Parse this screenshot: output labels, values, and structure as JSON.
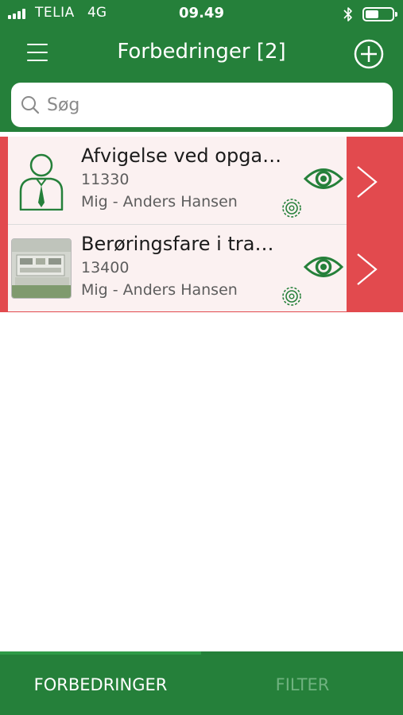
{
  "status_bar": {
    "carrier": "TELIA",
    "network": "4G",
    "time": "09.49",
    "signal_bars": 4,
    "battery_level": 0.35
  },
  "header": {
    "title": "Forbedringer [2]",
    "menu_icon": "hamburger-icon",
    "add_icon": "plus-circle-icon"
  },
  "search": {
    "placeholder": "Søg",
    "value": ""
  },
  "items": [
    {
      "title": "Afvigelse ved opga…",
      "id": "11330",
      "owner": "Mig - Anders Hansen",
      "thumbnail": "person-icon"
    },
    {
      "title": "Berøringsfare i tra…",
      "id": "13400",
      "owner": "Mig - Anders Hansen",
      "thumbnail": "photo"
    }
  ],
  "tabs": [
    {
      "label": "FORBEDRINGER",
      "active": true
    },
    {
      "label": "FILTER",
      "active": false
    }
  ],
  "colors": {
    "brand_green": "#25803a",
    "accent_red": "#e24a4e",
    "row_background": "#fbf1f1",
    "inactive_tab": "#6fb27f"
  }
}
